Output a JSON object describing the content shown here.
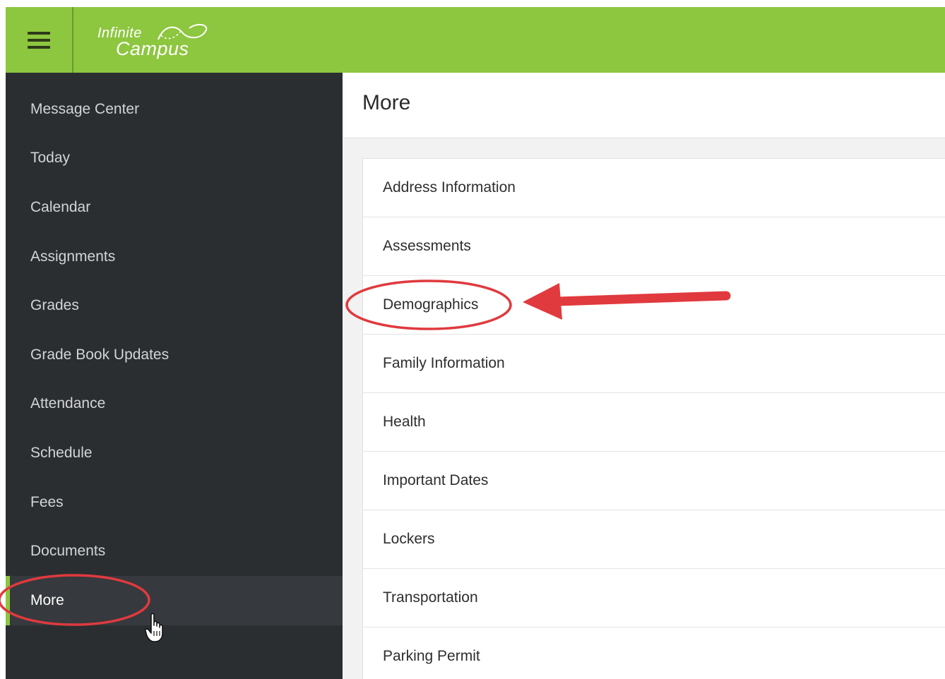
{
  "header": {
    "logo_line1": "Infinite",
    "logo_line2": "Campus",
    "brand_color": "#8dc63f",
    "menu_icon": "hamburger-menu-icon"
  },
  "sidebar": {
    "items": [
      {
        "label": "Message Center"
      },
      {
        "label": "Today"
      },
      {
        "label": "Calendar"
      },
      {
        "label": "Assignments"
      },
      {
        "label": "Grades"
      },
      {
        "label": "Grade Book Updates"
      },
      {
        "label": "Attendance"
      },
      {
        "label": "Schedule"
      },
      {
        "label": "Fees"
      },
      {
        "label": "Documents"
      },
      {
        "label": "More",
        "active": true
      }
    ],
    "background_color": "#2b2e31"
  },
  "main": {
    "title": "More",
    "items": [
      {
        "label": "Address Information"
      },
      {
        "label": "Assessments"
      },
      {
        "label": "Demographics"
      },
      {
        "label": "Family Information"
      },
      {
        "label": "Health"
      },
      {
        "label": "Important Dates"
      },
      {
        "label": "Lockers"
      },
      {
        "label": "Transportation"
      },
      {
        "label": "Parking Permit"
      }
    ]
  },
  "annotations": {
    "highlight_color": "#e03a3e",
    "highlighted_items": [
      "More",
      "Demographics"
    ],
    "pointer_icon": "hand-pointer-cursor-icon"
  }
}
